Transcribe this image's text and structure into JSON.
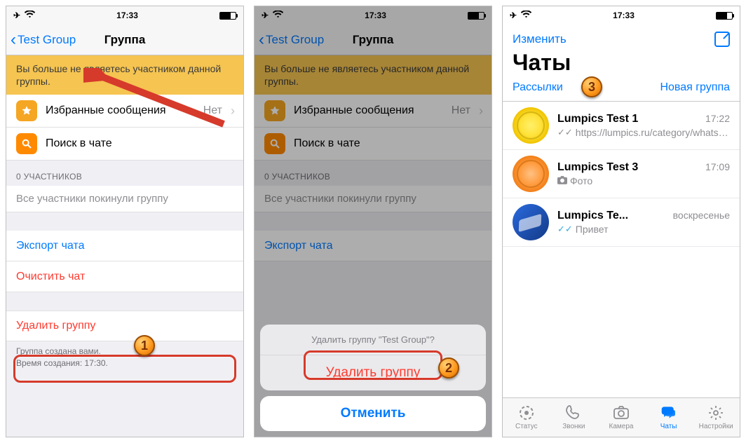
{
  "status": {
    "time": "17:33"
  },
  "p1": {
    "back": "Test Group",
    "title": "Группа",
    "banner": "Вы больше не являетесь участником данной группы.",
    "starred": "Избранные сообщения",
    "starred_value": "Нет",
    "search": "Поиск в чате",
    "participants_header": "0 УЧАСТНИКОВ",
    "participants_note": "Все участники покинули группу",
    "export": "Экспорт чата",
    "clear": "Очистить чат",
    "delete": "Удалить группу",
    "foot1": "Группа создана вами.",
    "foot2": "Время создания: 17:30."
  },
  "p2": {
    "back": "Test Group",
    "title": "Группа",
    "sheet_prompt": "Удалить группу \"Test Group\"?",
    "sheet_delete": "Удалить группу",
    "sheet_cancel": "Отменить"
  },
  "p3": {
    "edit": "Изменить",
    "title": "Чаты",
    "broadcasts": "Рассылки",
    "newgroup": "Новая группа",
    "chats": [
      {
        "name": "Lumpics Test 1",
        "time": "17:22",
        "preview": "https://lumpics.ru/category/whatsapp",
        "tick": "sent"
      },
      {
        "name": "Lumpics Test 3",
        "time": "17:09",
        "preview": "Фото",
        "icon": "camera"
      },
      {
        "name": "Lumpics Te...",
        "time": "воскресенье",
        "preview": "Привет",
        "tick": "read"
      }
    ],
    "tabs": {
      "status": "Статус",
      "calls": "Звонки",
      "camera": "Камера",
      "chats": "Чаты",
      "settings": "Настройки"
    }
  },
  "colors": {
    "accent": "#007aff",
    "danger": "#ff3b30",
    "banner": "#f5c451"
  },
  "badges": {
    "b1": "1",
    "b2": "2",
    "b3": "3"
  }
}
